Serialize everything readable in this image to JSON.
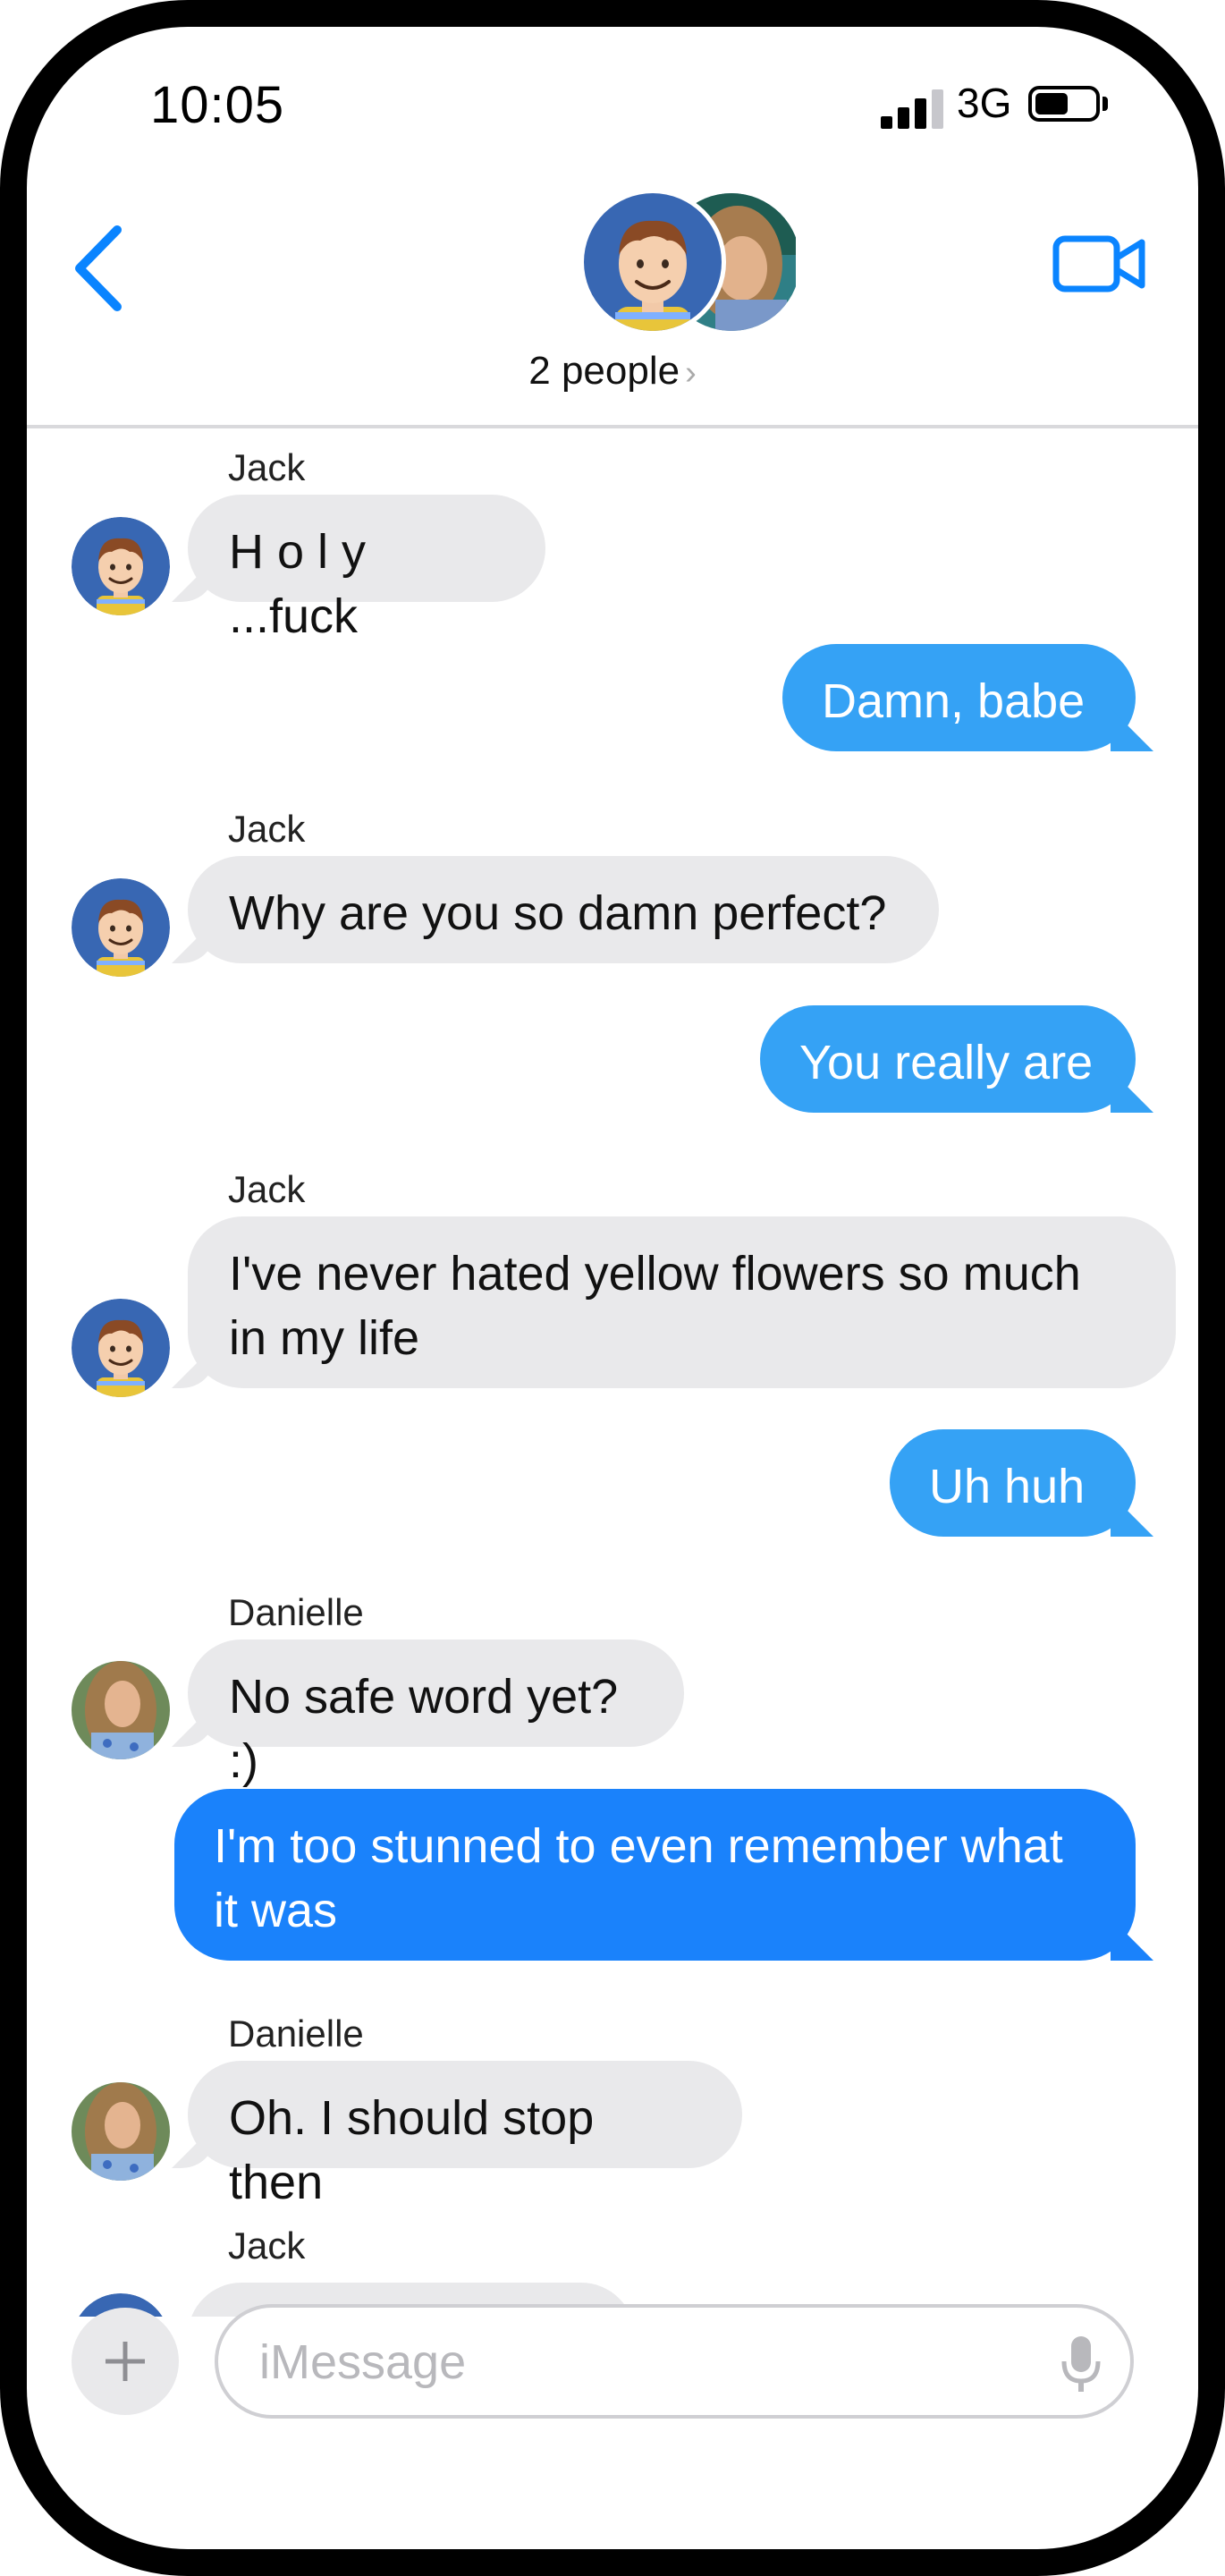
{
  "status_bar": {
    "time": "10:05",
    "network": "3G",
    "signal_bars": 4,
    "battery_level": 0.5
  },
  "header": {
    "back_icon": "chevron-left-icon",
    "video_icon": "video-camera-icon",
    "people_label": "2 people",
    "people_chevron": "›"
  },
  "colors": {
    "accent": "#0a84ff",
    "incoming_bubble": "#e9e9eb",
    "outgoing_bubble_light": "#35a2f5",
    "outgoing_bubble": "#1a82fb"
  },
  "messages": [
    {
      "sender": "Jack",
      "direction": "in",
      "lines": [
        "H o l y ...fuck"
      ]
    },
    {
      "direction": "out",
      "lines": [
        "Damn, babe"
      ]
    },
    {
      "sender": "Jack",
      "direction": "in",
      "lines": [
        "Why are you so damn perfect?"
      ]
    },
    {
      "direction": "out",
      "lines": [
        "You really are"
      ]
    },
    {
      "sender": "Jack",
      "direction": "in",
      "lines": [
        "I've never hated yellow flowers so much",
        "in my life"
      ]
    },
    {
      "direction": "out",
      "lines": [
        "Uh huh"
      ]
    },
    {
      "sender": "Danielle",
      "direction": "in",
      "lines": [
        "No safe word yet? :)"
      ]
    },
    {
      "direction": "out",
      "lines": [
        "I'm too stunned to even remember what",
        "it was"
      ]
    },
    {
      "sender": "Danielle",
      "direction": "in",
      "lines": [
        "Oh.  I should stop then"
      ]
    },
    {
      "sender": "Jack",
      "direction": "in",
      "lines": [
        ""
      ]
    }
  ],
  "composer": {
    "add_icon": "plus-icon",
    "placeholder": "iMessage",
    "value": "",
    "mic_icon": "microphone-icon"
  }
}
